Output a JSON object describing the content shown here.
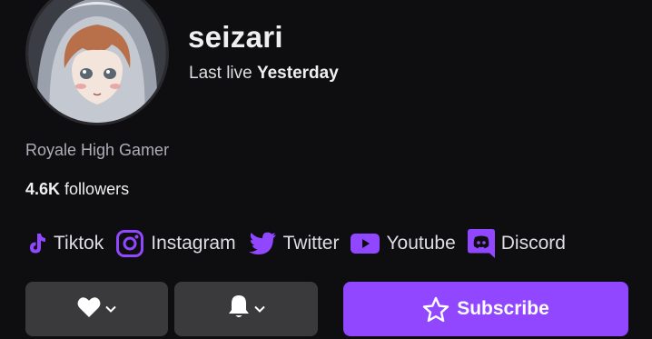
{
  "channel": {
    "username": "seizari",
    "last_live_label": "Last live",
    "last_live_value": "Yesterday",
    "bio": "Royale High Gamer",
    "followers_count": "4.6K",
    "followers_label": "followers"
  },
  "socials": [
    {
      "label": "Tiktok",
      "icon": "tiktok-icon"
    },
    {
      "label": "Instagram",
      "icon": "instagram-icon"
    },
    {
      "label": "Twitter",
      "icon": "twitter-icon"
    },
    {
      "label": "Youtube",
      "icon": "youtube-icon"
    },
    {
      "label": "Discord",
      "icon": "discord-icon"
    }
  ],
  "actions": {
    "follow_icon": "heart-icon",
    "notify_icon": "bell-icon",
    "subscribe_label": "Subscribe",
    "subscribe_icon": "star-icon"
  },
  "colors": {
    "background": "#0e0e10",
    "accent": "#9147ff",
    "button_gray": "#3a3a3d",
    "muted_text": "#adadb8"
  }
}
